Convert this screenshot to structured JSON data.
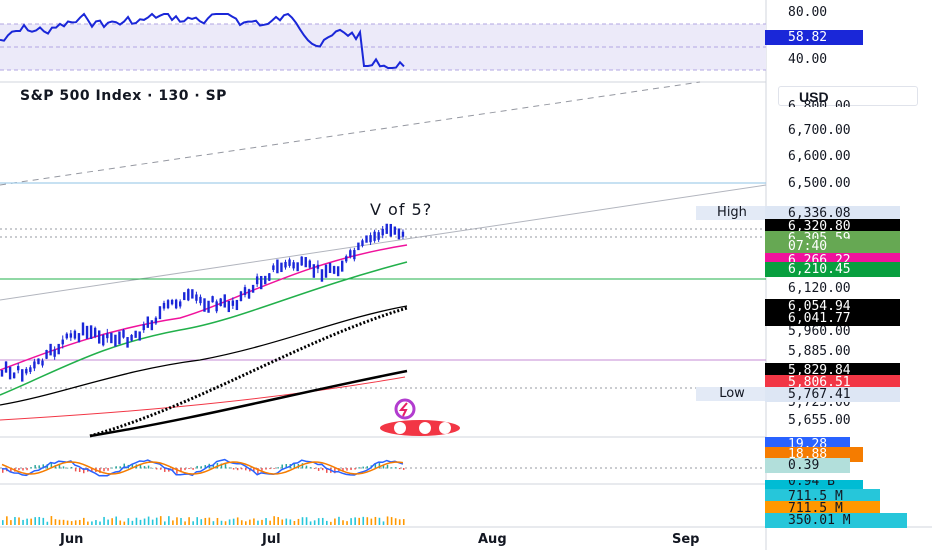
{
  "chart_title": "S&P 500 Index · 130 · SP",
  "annotation": "V of 5?",
  "currency_button": "USD",
  "months": [
    "Jun",
    "Jul",
    "Aug",
    "Sep"
  ],
  "rsi_axis": [
    "80.00",
    "40.00"
  ],
  "rsi_value": "58.82",
  "price_axis": [
    "6,800.00",
    "6,700.00",
    "6,600.00",
    "6,500.00",
    "6,120.00",
    "5,960.00",
    "5,885.00",
    "5,725.00",
    "5,655.00"
  ],
  "high_label": "High",
  "low_label": "Low",
  "badges": [
    {
      "id": "high",
      "text": "6,336.08",
      "bg": "#dde6f4",
      "fg": "#131722"
    },
    {
      "id": "last",
      "text": "6,320.80",
      "bg": "#000000",
      "fg": "#ffffff"
    },
    {
      "id": "close",
      "text": "6,305.59",
      "bg": "#66a853",
      "fg": "#ffffff"
    },
    {
      "id": "countdown",
      "text": "07:40",
      "bg": "#66a853",
      "fg": "#ffffff"
    },
    {
      "id": "ema_fast",
      "text": "6,266.22",
      "bg": "#f0129c",
      "fg": "#ffffff"
    },
    {
      "id": "ema_mid",
      "text": "6,210.45",
      "bg": "#089f3f",
      "fg": "#ffffff"
    },
    {
      "id": "sma50",
      "text": "6,054.94",
      "bg": "#000000",
      "fg": "#ffffff"
    },
    {
      "id": "dotted",
      "text": "6,041.77",
      "bg": "#000000",
      "fg": "#ffffff"
    },
    {
      "id": "sma200",
      "text": "5,829.84",
      "bg": "#000000",
      "fg": "#ffffff"
    },
    {
      "id": "red_ma",
      "text": "5,806.51",
      "bg": "#f23645",
      "fg": "#ffffff"
    },
    {
      "id": "low",
      "text": "5,767.41",
      "bg": "#dde6f4",
      "fg": "#131722"
    }
  ],
  "macd_badges": [
    {
      "id": "macd",
      "text": "19.28",
      "bg": "#2962ff",
      "fg": "#ffffff"
    },
    {
      "id": "signal",
      "text": "18.88",
      "bg": "#f57c00",
      "fg": "#ffffff"
    },
    {
      "id": "hist",
      "text": "0.39",
      "bg": "#b2dfdb",
      "fg": "#131722"
    }
  ],
  "volume_badges": [
    {
      "id": "vol_partial",
      "text": "0.94 B",
      "bg": "#00bcd4",
      "fg": "#131722"
    },
    {
      "id": "vol1",
      "text": "711.5 M",
      "bg": "#26c6da",
      "fg": "#131722"
    },
    {
      "id": "vol2",
      "text": "711.5 M",
      "bg": "#ff9800",
      "fg": "#131722"
    },
    {
      "id": "vol3",
      "text": "350.01 M",
      "bg": "#26c6da",
      "fg": "#131722"
    }
  ],
  "colors": {
    "rsi": "#1a27d8",
    "ema_fast": "#f0129c",
    "ema_mid": "#22b04b",
    "grid_border": "#e0e3eb"
  }
}
